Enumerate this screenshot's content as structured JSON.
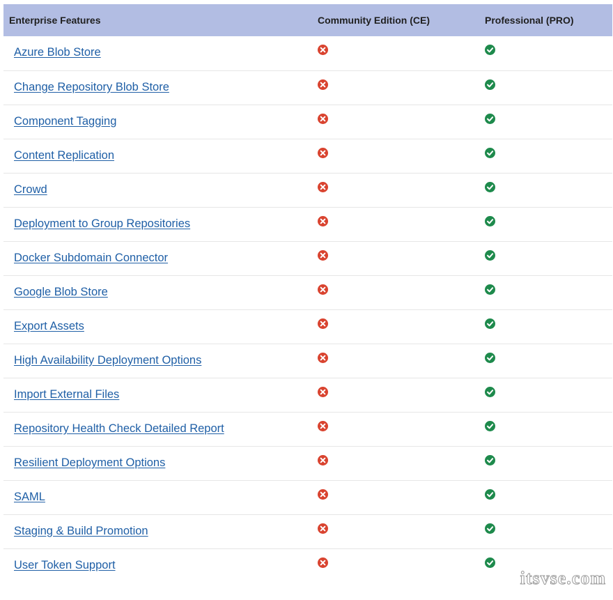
{
  "header": {
    "col_feature": "Enterprise Features",
    "col_ce": "Community Edition (CE)",
    "col_pro": "Professional (PRO)"
  },
  "status_icons": {
    "ce": "x-circle-icon",
    "pro": "check-circle-icon",
    "ce_color": "#d9432f",
    "pro_color": "#1e8a4c"
  },
  "features": [
    {
      "label": "Azure Blob Store",
      "ce": false,
      "pro": true
    },
    {
      "label": "Change Repository Blob Store",
      "ce": false,
      "pro": true
    },
    {
      "label": "Component Tagging",
      "ce": false,
      "pro": true
    },
    {
      "label": "Content Replication",
      "ce": false,
      "pro": true
    },
    {
      "label": "Crowd",
      "ce": false,
      "pro": true
    },
    {
      "label": "Deployment to Group Repositories",
      "ce": false,
      "pro": true
    },
    {
      "label": "Docker Subdomain Connector",
      "ce": false,
      "pro": true
    },
    {
      "label": "Google Blob Store",
      "ce": false,
      "pro": true
    },
    {
      "label": "Export Assets",
      "ce": false,
      "pro": true
    },
    {
      "label": "High Availability Deployment Options",
      "ce": false,
      "pro": true
    },
    {
      "label": "Import External Files",
      "ce": false,
      "pro": true
    },
    {
      "label": "Repository Health Check Detailed Report",
      "ce": false,
      "pro": true
    },
    {
      "label": "Resilient Deployment Options",
      "ce": false,
      "pro": true
    },
    {
      "label": "SAML",
      "ce": false,
      "pro": true
    },
    {
      "label": "Staging & Build Promotion",
      "ce": false,
      "pro": true
    },
    {
      "label": "User Token Support",
      "ce": false,
      "pro": true
    }
  ],
  "watermark": "itsvse.com"
}
